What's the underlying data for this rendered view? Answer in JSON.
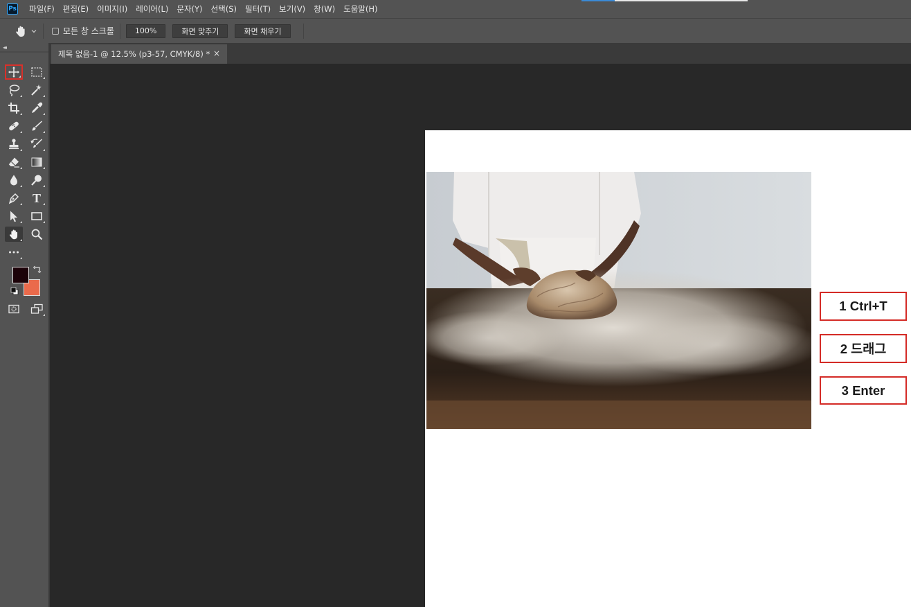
{
  "app": {
    "logo": "Ps"
  },
  "menu": [
    "파일(F)",
    "편집(E)",
    "이미지(I)",
    "레이어(L)",
    "문자(Y)",
    "선택(S)",
    "필터(T)",
    "보기(V)",
    "창(W)",
    "도움말(H)"
  ],
  "options_bar": {
    "tool_icon": "hand-icon",
    "scroll_all_windows_label": "모든 창 스크롤",
    "scroll_all_windows_checked": false,
    "zoom_button": "100%",
    "fit_screen_button": "화면 맞추기",
    "fill_screen_button": "화면 채우기"
  },
  "document_tab": {
    "title": "제목 없음-1 @ 12.5% (p3-57, CMYK/8) *",
    "close_glyph": "×"
  },
  "toolbox": {
    "tools": [
      "move-icon",
      "marquee-icon",
      "lasso-icon",
      "magic-wand-icon",
      "crop-icon",
      "eyedropper-icon",
      "healing-brush-icon",
      "brush-icon",
      "clone-stamp-icon",
      "history-brush-icon",
      "eraser-icon",
      "gradient-icon",
      "blur-icon",
      "dodge-icon",
      "pen-icon",
      "type-icon",
      "path-selection-icon",
      "rectangle-icon",
      "hand-icon",
      "zoom-icon",
      "more-tools-icon",
      "quick-mask-icon",
      "screen-mode-icon"
    ],
    "selected_tool": "move-icon",
    "active_tool": "hand-icon",
    "type_tool_glyph": "T",
    "foreground_color": "#1b0208",
    "background_color": "#ea6a4b"
  },
  "steps": {
    "step1": "1 Ctrl+T",
    "step2": "2 드래그",
    "step3": "3 Enter"
  },
  "colors": {
    "highlight_red": "#d42b26",
    "document_background": "#ffffff"
  }
}
